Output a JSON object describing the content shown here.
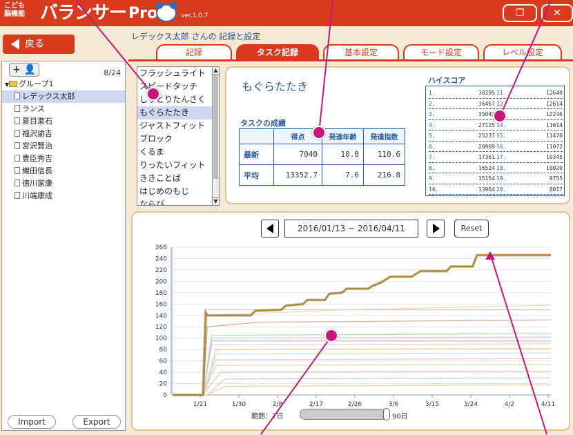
{
  "app": {
    "brand_small_1": "こども",
    "brand_small_2": "脳機能",
    "brand_main": "バランサー",
    "brand_pro": "Pro",
    "version": "ver.1.0.7",
    "restore_icon": "restore-window-icon",
    "close_icon": "close-icon",
    "accent": "#d93a1e"
  },
  "nav": {
    "back_label": "戻る",
    "user_title": "レデックス太郎 さんの 記録と設定",
    "tabs": [
      {
        "label": "記録",
        "active": false
      },
      {
        "label": "タスク記録",
        "active": true
      },
      {
        "label": "基本設定",
        "active": false
      },
      {
        "label": "モード設定",
        "active": false
      },
      {
        "label": "レベル設定",
        "active": false
      }
    ]
  },
  "sidebar": {
    "add_label": "+ 👤",
    "page_count": "8/24",
    "group_label": "グループ1",
    "members": [
      "レデックス太郎",
      "ランス",
      "夏目漱石",
      "福沢諭吉",
      "宮沢賢治",
      "豊臣秀吉",
      "織田信長",
      "徳川家康",
      "川端康成"
    ],
    "selected_member": "レデックス太郎",
    "import_label": "Import",
    "export_label": "Export"
  },
  "tasks": {
    "items": [
      "フラッシュライト",
      "スピードタッチ",
      "しりとりたんさく",
      "もぐらたたき",
      "ジャストフィット",
      "ブロック",
      "くるま",
      "りったいフィット",
      "ききことば",
      "はじめのもじ",
      "ならび"
    ],
    "selected": "もぐらたたき"
  },
  "detail": {
    "task_name": "もぐらたたき",
    "results_label": "タスクの成績",
    "col_headers": [
      "得点",
      "発達年齢",
      "発達指数"
    ],
    "rows": [
      {
        "label": "最新",
        "values": [
          "7040",
          "10.0",
          "110.6"
        ]
      },
      {
        "label": "平均",
        "values": [
          "13352.7",
          "7.6",
          "216.8"
        ]
      }
    ],
    "highscore_label": "ハイスコア",
    "highscores": [
      {
        "rank": "1.",
        "score": "38295"
      },
      {
        "rank": "2.",
        "score": "36467"
      },
      {
        "rank": "3.",
        "score": "35042"
      },
      {
        "rank": "4.",
        "score": "27125"
      },
      {
        "rank": "5.",
        "score": "25237"
      },
      {
        "rank": "6.",
        "score": "20909"
      },
      {
        "rank": "7.",
        "score": "17361"
      },
      {
        "rank": "8.",
        "score": "16524"
      },
      {
        "rank": "9.",
        "score": "15154"
      },
      {
        "rank": "10.",
        "score": "13964"
      },
      {
        "rank": "11.",
        "score": "12640"
      },
      {
        "rank": "12.",
        "score": "12614"
      },
      {
        "rank": "13.",
        "score": "12246"
      },
      {
        "rank": "14.",
        "score": "11614"
      },
      {
        "rank": "15.",
        "score": "11470"
      },
      {
        "rank": "16.",
        "score": "11072"
      },
      {
        "rank": "17.",
        "score": "10345"
      },
      {
        "rank": "18.",
        "score": "10020"
      },
      {
        "rank": "19.",
        "score": "9755"
      },
      {
        "rank": "20.",
        "score": "8017"
      }
    ]
  },
  "chart_controls": {
    "date_range": "2016/01/13 ~ 2016/04/11",
    "reset_label": "Reset",
    "range_label": "範囲：7日",
    "range_max": "90日",
    "prev_icon": "triangle-left-icon",
    "next_icon": "triangle-right-icon"
  },
  "chart_data": {
    "type": "line",
    "x_labels": [
      "1/21",
      "1/30",
      "2/8",
      "2/17",
      "2/26",
      "3/6",
      "3/15",
      "3/24",
      "4/2",
      "4/11"
    ],
    "y_ticks": [
      0,
      20,
      40,
      60,
      80,
      100,
      120,
      140,
      160,
      180,
      200,
      220,
      240,
      260
    ],
    "ylim": [
      0,
      260
    ],
    "grid": true,
    "main_series": {
      "color": "#b08a2a",
      "points": [
        [
          0,
          0
        ],
        [
          7,
          0
        ],
        [
          7.6,
          145
        ],
        [
          8,
          140
        ],
        [
          18,
          140
        ],
        [
          19,
          148
        ],
        [
          25,
          150
        ],
        [
          26,
          157
        ],
        [
          30,
          160
        ],
        [
          31,
          167
        ],
        [
          35,
          167
        ],
        [
          36,
          178
        ],
        [
          39,
          180
        ],
        [
          40,
          187
        ],
        [
          45,
          187
        ],
        [
          46,
          192
        ],
        [
          48,
          198
        ],
        [
          50,
          208
        ],
        [
          55,
          208
        ],
        [
          56,
          213
        ],
        [
          57,
          218
        ],
        [
          63,
          218
        ],
        [
          64,
          226
        ],
        [
          69,
          226
        ],
        [
          70,
          246
        ],
        [
          87,
          246
        ]
      ]
    },
    "background_series": [
      {
        "color": "#e2b6c8",
        "points": [
          [
            0,
            0
          ],
          [
            7,
            0
          ],
          [
            7.6,
            150
          ],
          [
            10,
            150
          ],
          [
            87,
            150
          ]
        ]
      },
      {
        "color": "#f1d6a6",
        "points": [
          [
            0,
            0
          ],
          [
            7,
            0
          ],
          [
            8,
            140
          ],
          [
            40,
            150
          ],
          [
            87,
            158
          ]
        ]
      },
      {
        "color": "#c8a58c",
        "points": [
          [
            0,
            0
          ],
          [
            7,
            0
          ],
          [
            8,
            120
          ],
          [
            20,
            128
          ],
          [
            87,
            132
          ]
        ]
      },
      {
        "color": "#a8d8b0",
        "points": [
          [
            0,
            0
          ],
          [
            7,
            0
          ],
          [
            9,
            105
          ],
          [
            87,
            108
          ]
        ]
      },
      {
        "color": "#b7cfe6",
        "points": [
          [
            0,
            0
          ],
          [
            7,
            0
          ],
          [
            9,
            100
          ],
          [
            87,
            102
          ]
        ]
      },
      {
        "color": "#e8b0a0",
        "points": [
          [
            0,
            0
          ],
          [
            7,
            0
          ],
          [
            9,
            95
          ],
          [
            87,
            95
          ]
        ]
      },
      {
        "color": "#d6c9ea",
        "points": [
          [
            0,
            0
          ],
          [
            7,
            0
          ],
          [
            9,
            88
          ],
          [
            87,
            90
          ]
        ]
      },
      {
        "color": "#e6d08a",
        "points": [
          [
            0,
            0
          ],
          [
            7,
            0
          ],
          [
            10,
            80
          ],
          [
            87,
            82
          ]
        ]
      },
      {
        "color": "#b9e0df",
        "points": [
          [
            0,
            0
          ],
          [
            7,
            0
          ],
          [
            10,
            72
          ],
          [
            87,
            74
          ]
        ]
      },
      {
        "color": "#f0c0d8",
        "points": [
          [
            0,
            0
          ],
          [
            7,
            0
          ],
          [
            10,
            62
          ],
          [
            87,
            64
          ]
        ]
      },
      {
        "color": "#cfd8a0",
        "points": [
          [
            0,
            0
          ],
          [
            7,
            0
          ],
          [
            10,
            52
          ],
          [
            87,
            54
          ]
        ]
      },
      {
        "color": "#d8c0a8",
        "points": [
          [
            0,
            0
          ],
          [
            7,
            0
          ],
          [
            11,
            40
          ],
          [
            87,
            42
          ]
        ]
      },
      {
        "color": "#c0c8d8",
        "points": [
          [
            0,
            0
          ],
          [
            8,
            0
          ],
          [
            12,
            28
          ],
          [
            87,
            30
          ]
        ]
      },
      {
        "color": "#f5c8a0",
        "points": [
          [
            0,
            0
          ],
          [
            8,
            0
          ],
          [
            12,
            15
          ],
          [
            87,
            18
          ]
        ]
      }
    ]
  },
  "annotations": {
    "color": "#c8157e"
  }
}
